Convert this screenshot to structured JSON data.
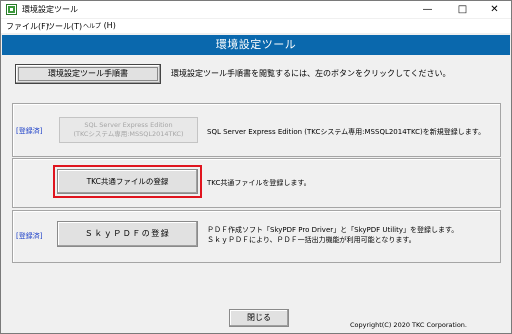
{
  "window": {
    "title": "環境設定ツール",
    "minimize_glyph": "—",
    "maximize_glyph": "□",
    "close_glyph": "✕"
  },
  "menu": {
    "file": "ファイル(F)",
    "tools": "ツール(T)",
    "help_prefix": "ヘルプ",
    "help_suffix": "(H)"
  },
  "header": {
    "title": "環境設定ツール"
  },
  "manual": {
    "button_label": "環境設定ツール手順書",
    "note": "環境設定ツール手順書を閲覧するには、左のボタンをクリックしてください。"
  },
  "sql": {
    "status": "[登録済]",
    "button_line1": "SQL Server Express Edition",
    "button_line2": "(TKCシステム専用:MSSQL2014TKC)",
    "description": "SQL Server Express Edition (TKCシステム専用:MSSQL2014TKC)を新規登録します。"
  },
  "tkc": {
    "button_label": "TKC共通ファイルの登録",
    "description": "TKC共通ファイルを登録します。"
  },
  "skypdf": {
    "status": "[登録済]",
    "button_label": "ＳｋｙＰＤＦの登録",
    "description_line1": "ＰＤＦ作成ソフト「SkyPDF Pro Driver」と「SkyPDF Utility」を登録します。",
    "description_line2": "ＳｋｙＰＤＦにより、ＰＤＦ一括出力機能が利用可能となります。"
  },
  "footer": {
    "close_label": "閉じる",
    "copyright": "Copyright(C) 2020 TKC Corporation."
  }
}
